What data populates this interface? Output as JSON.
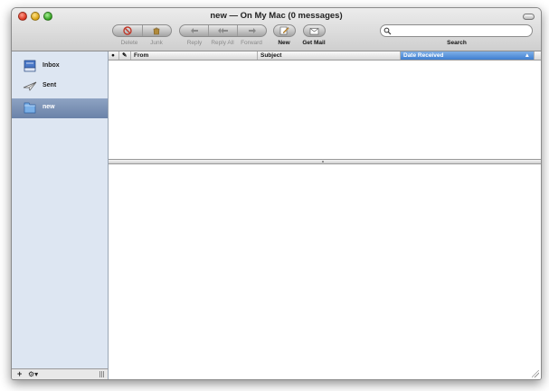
{
  "window": {
    "title": "new — On My Mac (0 messages)"
  },
  "toolbar": {
    "delete_label": "Delete",
    "junk_label": "Junk",
    "reply_label": "Reply",
    "reply_all_label": "Reply All",
    "forward_label": "Forward",
    "new_label": "New",
    "get_mail_label": "Get Mail",
    "search_label": "Search",
    "search_value": ""
  },
  "sidebar": {
    "items": [
      {
        "label": "Inbox",
        "icon": "inbox-tray-icon"
      },
      {
        "label": "Sent",
        "icon": "paper-plane-icon"
      },
      {
        "label": "new",
        "icon": "folder-icon",
        "selected": true
      }
    ],
    "add_label": "+",
    "action_label": "⚙▾"
  },
  "message_list": {
    "columns": [
      "●",
      "✎",
      "From",
      "Subject",
      "Date Received"
    ],
    "sorted_column": "Date Received",
    "sort_indicator": "▲",
    "rows": []
  },
  "colors": {
    "selection": "#6a82a8",
    "sorted_header": "#3f7fd0",
    "sidebar_bg": "#dde6f2"
  }
}
